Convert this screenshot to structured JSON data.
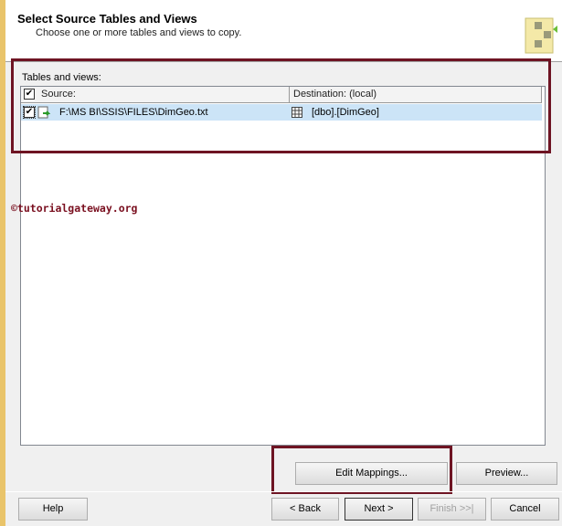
{
  "header": {
    "title": "Select Source Tables and Views",
    "subtitle": "Choose one or more tables and views to copy."
  },
  "grid": {
    "label": "Tables and views:",
    "columns": [
      "Source:",
      "Destination: (local)"
    ],
    "rows": [
      {
        "checked": true,
        "source": "F:\\MS BI\\SSIS\\FILES\\DimGeo.txt",
        "destination": "[dbo].[DimGeo]"
      }
    ]
  },
  "watermark": "©tutorialgateway.org",
  "buttons": {
    "edit_mappings": "Edit Mappings...",
    "preview": "Preview...",
    "help": "Help",
    "back": "< Back",
    "next": "Next >",
    "finish": "Finish >>|",
    "cancel": "Cancel"
  }
}
